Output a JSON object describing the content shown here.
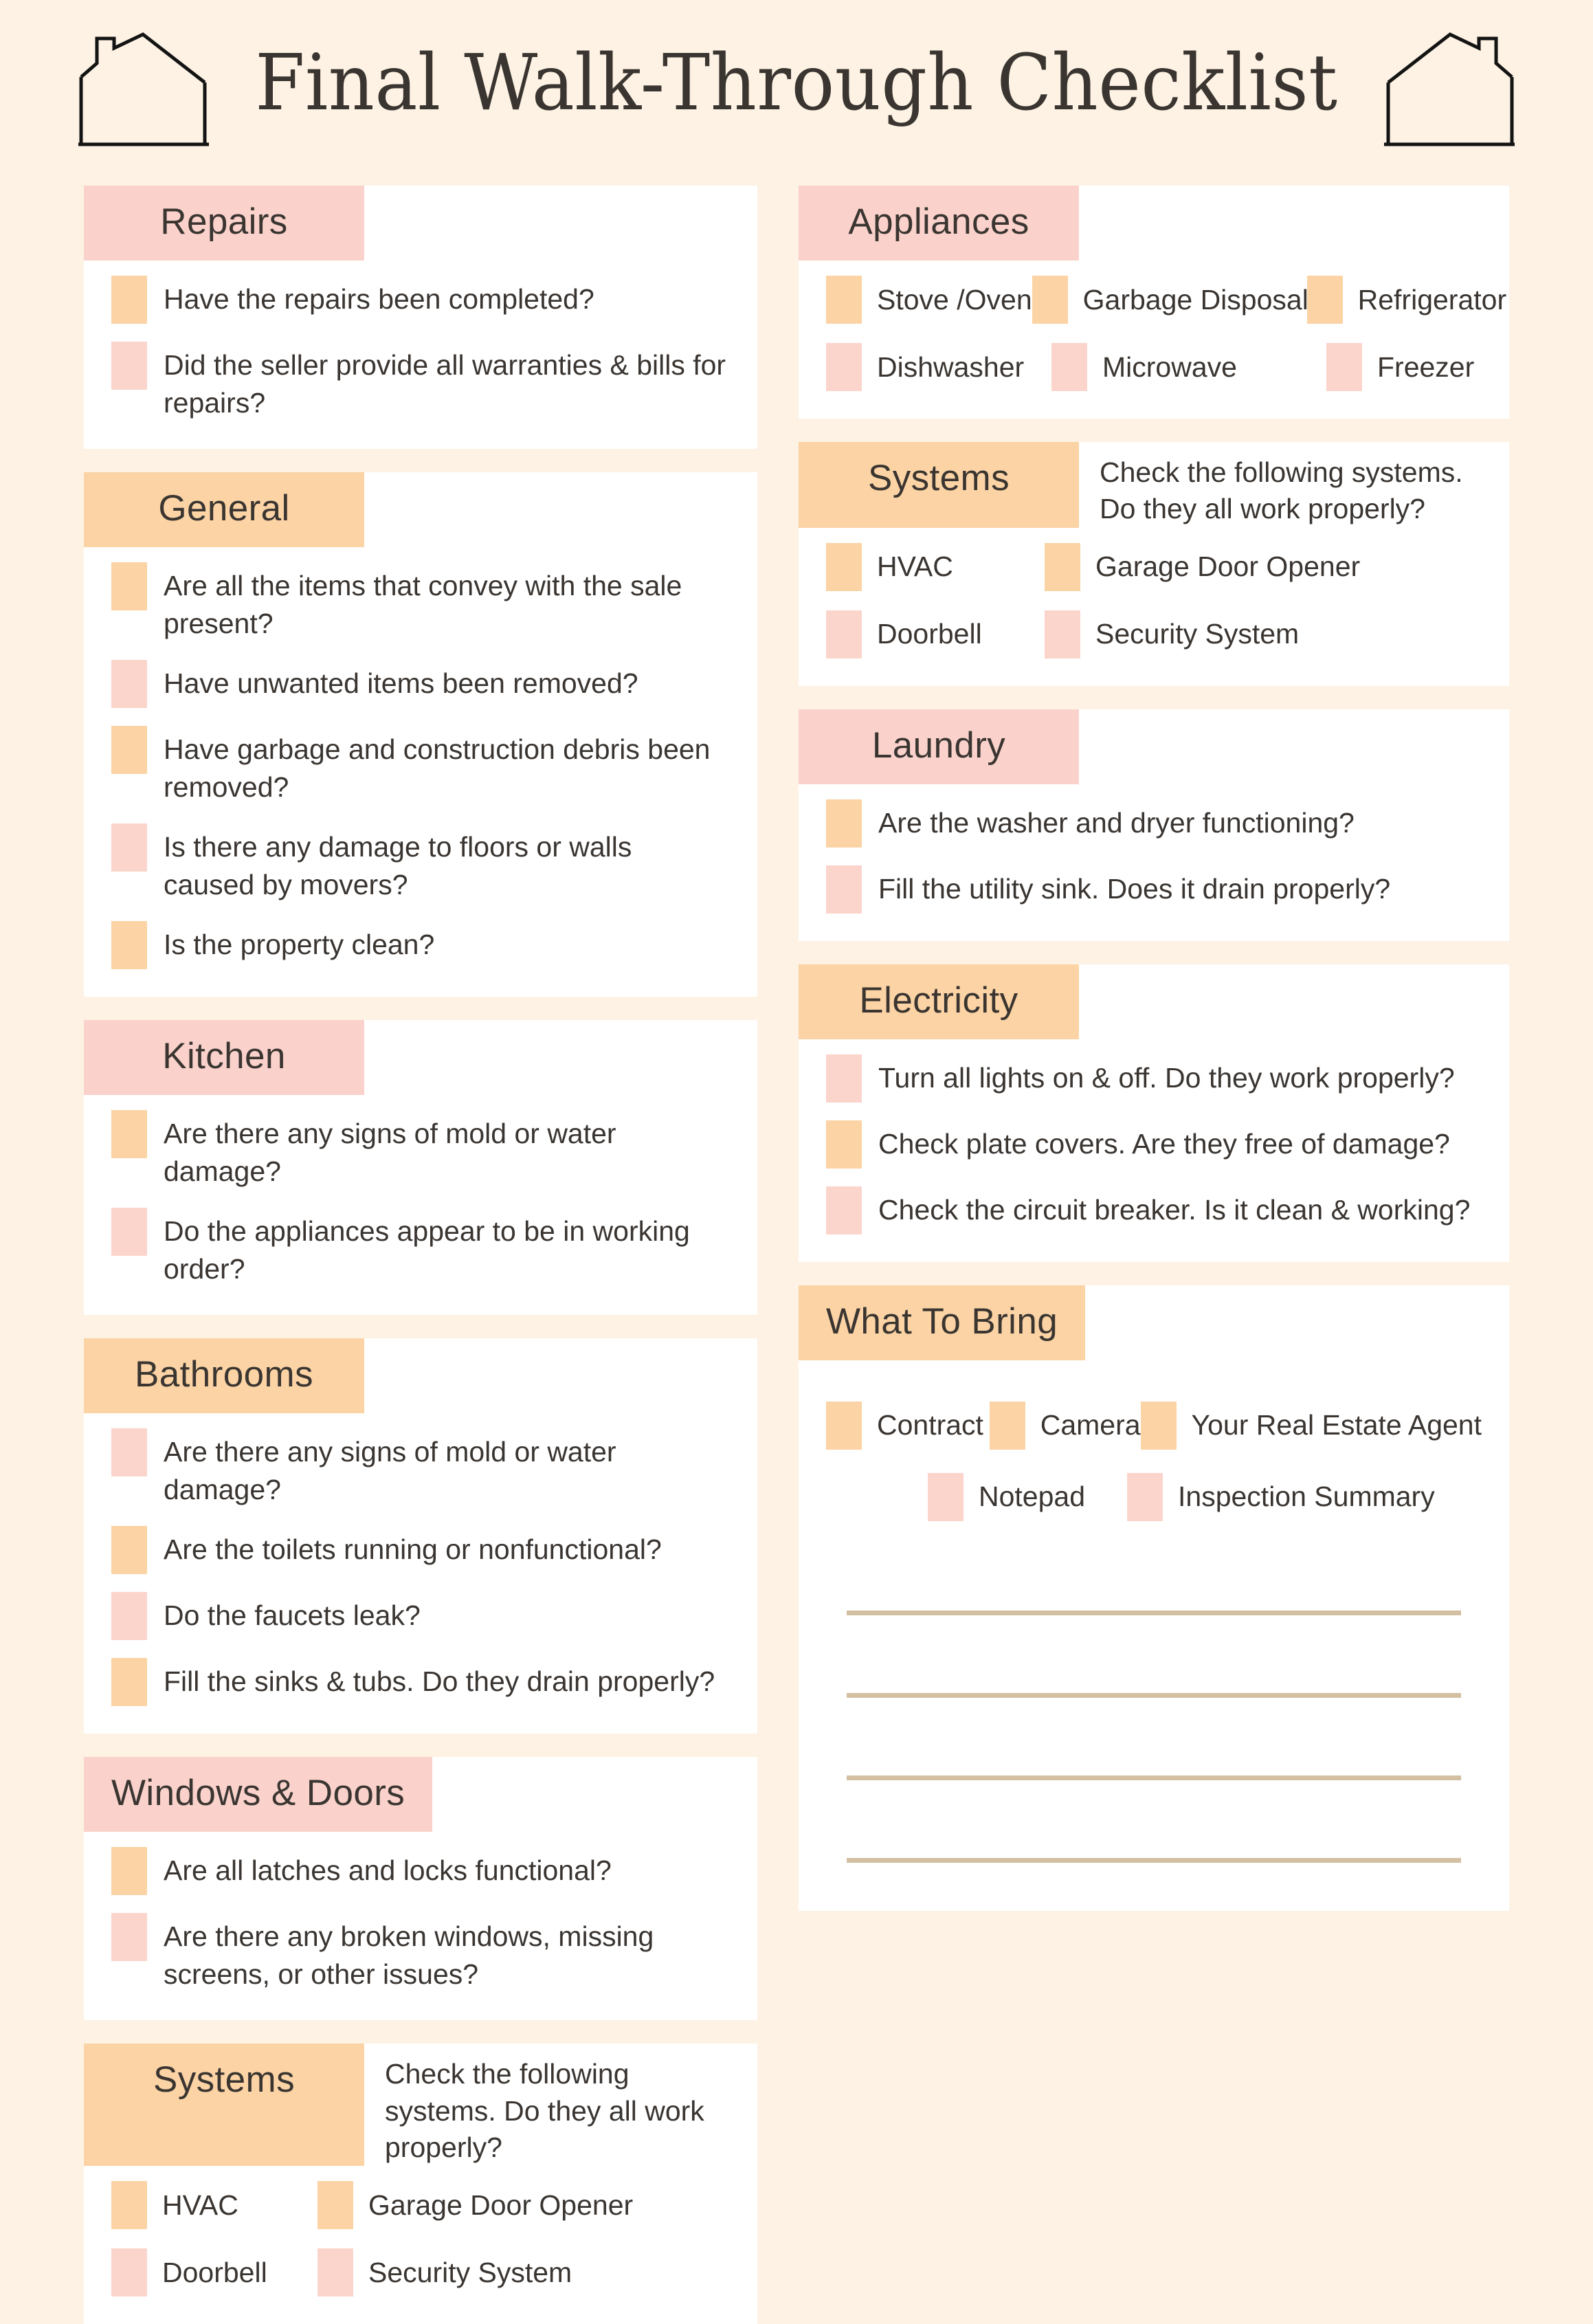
{
  "title": "Final Walk-Through Checklist",
  "colors": {
    "page_background": "#FDF2E3",
    "card_background": "#FFFFFF",
    "pink": "#FAD2CB",
    "orange": "#FBD3A4",
    "box_pink": "#FBD5CC",
    "box_orange": "#FBD3A4",
    "text": "#3A3531",
    "rule_line": "#D3BFA1"
  },
  "left_column": {
    "repairs": {
      "heading": "Repairs",
      "items": [
        {
          "label": "Have the repairs been completed?",
          "box": "orange"
        },
        {
          "label": "Did the seller provide all warranties & bills for repairs?",
          "box": "pink"
        }
      ]
    },
    "general": {
      "heading": "General",
      "items": [
        {
          "label": "Are all the items that convey with the sale present?",
          "box": "orange"
        },
        {
          "label": "Have unwanted items been removed?",
          "box": "pink"
        },
        {
          "label": "Have garbage and construction debris been removed?",
          "box": "orange"
        },
        {
          "label": "Is there any damage to floors or walls caused by movers?",
          "box": "pink"
        },
        {
          "label": "Is the property clean?",
          "box": "orange"
        }
      ]
    },
    "kitchen": {
      "heading": "Kitchen",
      "items": [
        {
          "label": "Are there any signs of mold or water damage?",
          "box": "orange"
        },
        {
          "label": "Do the appliances appear to be in working order?",
          "box": "pink"
        }
      ]
    },
    "bathrooms": {
      "heading": "Bathrooms",
      "items": [
        {
          "label": "Are there any signs of mold or water damage?",
          "box": "pink"
        },
        {
          "label": "Are the toilets running or nonfunctional?",
          "box": "orange"
        },
        {
          "label": "Do the faucets leak?",
          "box": "pink"
        },
        {
          "label": "Fill the sinks & tubs. Do they drain properly?",
          "box": "orange"
        }
      ]
    },
    "windows_doors": {
      "heading": "Windows & Doors",
      "items": [
        {
          "label": "Are all latches and locks functional?",
          "box": "orange"
        },
        {
          "label": "Are there any broken windows, missing screens, or other issues?",
          "box": "pink"
        }
      ]
    },
    "systems": {
      "heading": "Systems",
      "note": "Check the following systems. Do they all work properly?",
      "items": [
        {
          "label": "HVAC",
          "box": "orange"
        },
        {
          "label": "Garage Door Opener",
          "box": "orange"
        },
        {
          "label": "Doorbell",
          "box": "pink"
        },
        {
          "label": "Security System",
          "box": "pink"
        }
      ]
    }
  },
  "right_column": {
    "appliances": {
      "heading": "Appliances",
      "items": [
        {
          "label": "Stove /Oven",
          "box": "orange"
        },
        {
          "label": "Garbage Disposal",
          "box": "orange"
        },
        {
          "label": "Refrigerator",
          "box": "orange"
        },
        {
          "label": "Dishwasher",
          "box": "pink"
        },
        {
          "label": "Microwave",
          "box": "pink"
        },
        {
          "label": "Freezer",
          "box": "pink"
        }
      ]
    },
    "systems": {
      "heading": "Systems",
      "note": "Check the following systems. Do they all work properly?",
      "items": [
        {
          "label": "HVAC",
          "box": "orange"
        },
        {
          "label": "Garage Door Opener",
          "box": "orange"
        },
        {
          "label": "Doorbell",
          "box": "pink"
        },
        {
          "label": "Security System",
          "box": "pink"
        }
      ]
    },
    "laundry": {
      "heading": "Laundry",
      "items": [
        {
          "label": "Are the washer and dryer functioning?",
          "box": "orange"
        },
        {
          "label": "Fill the utility sink. Does it drain properly?",
          "box": "pink"
        }
      ]
    },
    "electricity": {
      "heading": "Electricity",
      "items": [
        {
          "label": "Turn all lights on & off. Do they work properly?",
          "box": "pink"
        },
        {
          "label": "Check plate covers. Are they free of damage?",
          "box": "orange"
        },
        {
          "label": "Check the circuit breaker. Is it clean & working?",
          "box": "pink"
        }
      ]
    },
    "what_to_bring": {
      "heading": "What To Bring",
      "items": [
        {
          "label": "Contract",
          "box": "orange"
        },
        {
          "label": "Camera",
          "box": "orange"
        },
        {
          "label": "Your Real Estate Agent",
          "box": "orange"
        },
        {
          "label": "Notepad",
          "box": "pink"
        },
        {
          "label": "Inspection Summary",
          "box": "pink"
        }
      ],
      "note_line_count": 4
    }
  }
}
